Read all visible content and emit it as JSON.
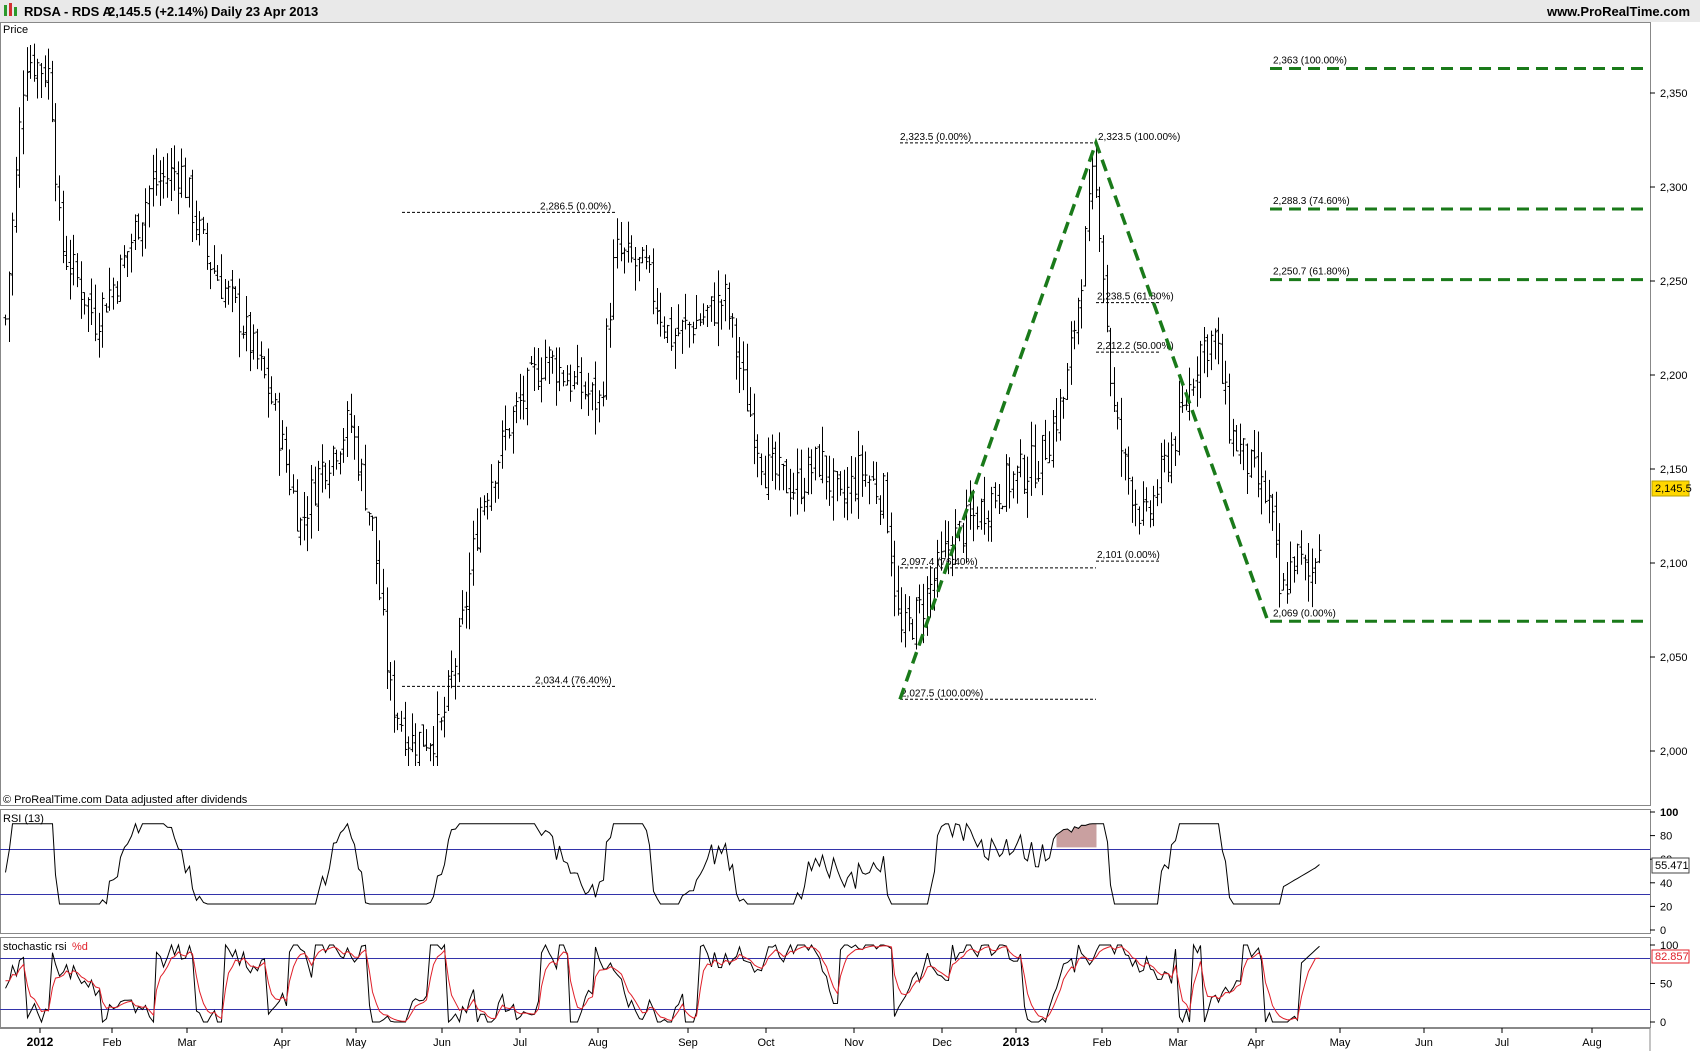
{
  "header": {
    "symbol": "RDSA - RDS  A",
    "price": "2,145.5 (+2.14%)",
    "period": "Daily  23 Apr 2013",
    "site": "www.ProRealTime.com"
  },
  "price_panel": {
    "label": "Price",
    "footer": "© ProRealTime.com  Data adjusted after dividends",
    "last_price_tag": "2,145.5",
    "y_ticks": [
      "2,350",
      "2,300",
      "2,250",
      "2,200",
      "2,150",
      "2,100",
      "2,050",
      "2,000"
    ]
  },
  "rsi_panel": {
    "label": "RSI (13)",
    "value_tag": "55.471",
    "y_ticks": [
      "100",
      "80",
      "60",
      "40",
      "20",
      "0"
    ]
  },
  "stoch_panel": {
    "label": "stochastic rsi",
    "label_suffix": "%d",
    "value_tag": "82.857",
    "y_ticks": [
      "100",
      "50",
      "0"
    ]
  },
  "x_axis": {
    "labels": [
      "2012",
      "Feb",
      "Mar",
      "Apr",
      "May",
      "Jun",
      "Jul",
      "Aug",
      "Sep",
      "Oct",
      "Nov",
      "Dec",
      "2013",
      "Feb",
      "Mar",
      "Apr",
      "May",
      "Jun",
      "Jul",
      "Aug"
    ]
  },
  "fib_labels": {
    "a": "2,286.5 (0.00%)",
    "b": "2,034.4 (76.40%)",
    "c": "2,323.5 (0.00%)",
    "d": "2,323.5 (100.00%)",
    "e": "2,238.5 (61.80%)",
    "f": "2,212.2 (50.00%)",
    "g": "2,101 (0.00%)",
    "h": "2,097.4 (76.40%)",
    "i": "2,027.5 (100.00%)",
    "j": "2,363 (100.00%)",
    "k": "2,288.3 (74.60%)",
    "l": "2,250.7 (61.80%)",
    "m": "2,069 (0.00%)"
  },
  "colors": {
    "up_line": "#000000",
    "green_dashed": "#1a7a1a",
    "rsi_band": "#3333aa",
    "stoch_k": "#000000",
    "stoch_d": "#e0202a",
    "price_tag_bg": "#ffd700",
    "rsi_highlight": "#c9a0a0"
  },
  "chart_data": {
    "type": "ohlc",
    "xlabel": "",
    "ylabel": "Price",
    "ylim": [
      1990,
      2390
    ],
    "key_points": [
      {
        "date": "2012-05-21",
        "price": 2000
      },
      {
        "date": "2012-08-06",
        "price": 2286.5
      },
      {
        "date": "2012-11-16",
        "price": 2027.5
      },
      {
        "date": "2013-01-29",
        "price": 2323.5
      },
      {
        "date": "2013-02-18",
        "price": 2101
      },
      {
        "date": "2013-03-05",
        "price": 2232
      },
      {
        "date": "2013-04-03",
        "price": 2069
      },
      {
        "date": "2013-04-23",
        "price": 2145.5
      }
    ],
    "fib_levels": [
      2363,
      2288.3,
      2250.7,
      2069
    ],
    "rsi_last": 55.471,
    "stoch_last": 82.857
  }
}
